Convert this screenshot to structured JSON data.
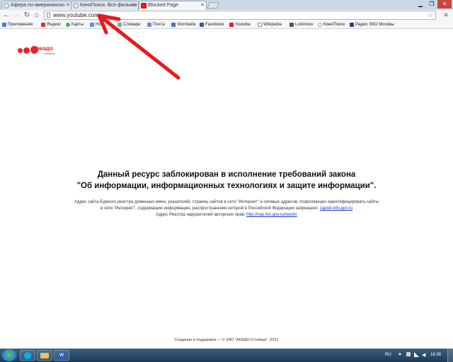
{
  "tabs": [
    {
      "label": "Афера по-американски",
      "active": false
    },
    {
      "label": "КиноПоиск. Все фильмы",
      "active": false
    },
    {
      "label": "Blocked Page",
      "active": true
    }
  ],
  "omnibox": {
    "url": "www.youtube.com"
  },
  "bookmarks": [
    {
      "label": "Приложения",
      "color": "#4a7bd4"
    },
    {
      "label": "Яндекс",
      "color": "#e0352b"
    },
    {
      "label": "Карты",
      "color": "#4caf50"
    },
    {
      "label": "Нов",
      "color": "#6d8fc7"
    },
    {
      "label": "Словари",
      "color": "#8aa0b8"
    },
    {
      "label": "Почта",
      "color": "#6d8fc7"
    },
    {
      "label": "Vkontakte",
      "color": "#4c75a3"
    },
    {
      "label": "Facebook",
      "color": "#3b5998"
    },
    {
      "label": "Youtube",
      "color": "#e02020"
    },
    {
      "label": "Wikipedia",
      "color": "#888888"
    },
    {
      "label": "Lurkmore",
      "color": "#555555"
    },
    {
      "label": "КиноПоиск",
      "color": "#999999"
    },
    {
      "label": "Радио ЭХО Москвы",
      "color": "#2a3f8f"
    }
  ],
  "logo": {
    "name": "акадо",
    "sub": "телеком"
  },
  "message": {
    "line1": "Данный ресурс заблокирован в исполнение требований закона",
    "line2": "\"Об информации, информационных технологиях и защите информации\".",
    "info1": "Адрес сайта Единого реестра доменных имен, указателей, страниц сайтов в сети \"Интернет\" и сетевых адресов, позволяющих идентифицировать сайты",
    "info2_text": "в сети \"Интернет\", содержащие информацию, распространение которой в Российской Федерации запрещено:",
    "info2_link": "zapret-info.gov.ru",
    "info3_text": "Адрес Реестра нарушителей авторских прав:",
    "info3_link": "http://nap.rkn.gov.ru/reestr/"
  },
  "footer": "Создание и поддержка — © ЗАО \"АКАДО-Столица\", 2012",
  "taskbar": {
    "lang": "RU",
    "time": "18:26"
  },
  "colors": {
    "brand_red": "#e52629",
    "link_blue": "#1a33cc",
    "annotation_arrow": "#e8191f"
  }
}
